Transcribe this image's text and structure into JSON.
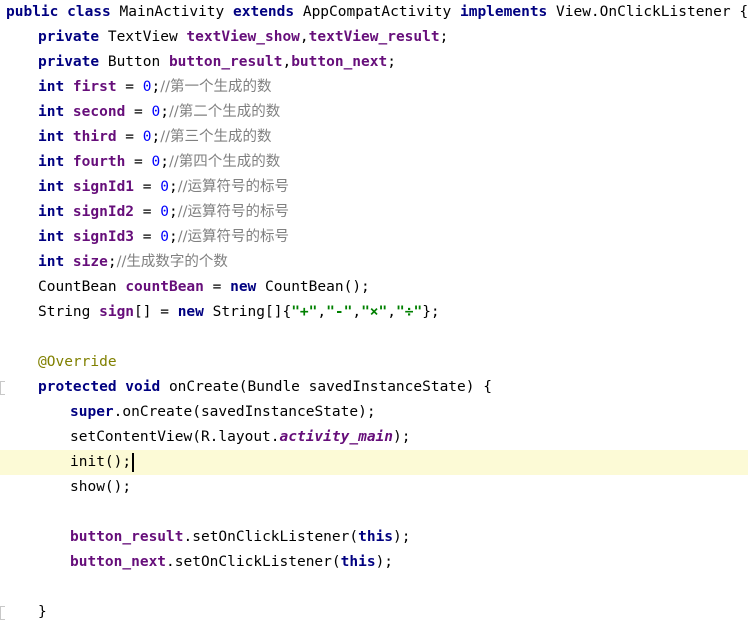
{
  "editor": {
    "lines": [
      {
        "indent": 0,
        "tokens": [
          {
            "t": "public class ",
            "c": "kw"
          },
          {
            "t": "MainActivity ",
            "c": "plain"
          },
          {
            "t": "extends ",
            "c": "kw"
          },
          {
            "t": "AppCompatActivity ",
            "c": "plain"
          },
          {
            "t": "implements ",
            "c": "kw"
          },
          {
            "t": "View.OnClickListener {",
            "c": "plain"
          }
        ]
      },
      {
        "indent": 1,
        "tokens": [
          {
            "t": "private ",
            "c": "kw"
          },
          {
            "t": "TextView ",
            "c": "plain"
          },
          {
            "t": "textView_show",
            "c": "fld"
          },
          {
            "t": ",",
            "c": "plain"
          },
          {
            "t": "textView_result",
            "c": "fld"
          },
          {
            "t": ";",
            "c": "plain"
          }
        ]
      },
      {
        "indent": 1,
        "tokens": [
          {
            "t": "private ",
            "c": "kw"
          },
          {
            "t": "Button ",
            "c": "plain"
          },
          {
            "t": "button_result",
            "c": "fld"
          },
          {
            "t": ",",
            "c": "plain"
          },
          {
            "t": "button_next",
            "c": "fld"
          },
          {
            "t": ";",
            "c": "plain"
          }
        ]
      },
      {
        "indent": 1,
        "tokens": [
          {
            "t": "int ",
            "c": "kw"
          },
          {
            "t": "first",
            "c": "fld"
          },
          {
            "t": " = ",
            "c": "plain"
          },
          {
            "t": "0",
            "c": "num"
          },
          {
            "t": ";",
            "c": "plain"
          },
          {
            "t": "//第一个生成的数",
            "c": "cmt"
          }
        ]
      },
      {
        "indent": 1,
        "tokens": [
          {
            "t": "int ",
            "c": "kw"
          },
          {
            "t": "second",
            "c": "fld"
          },
          {
            "t": " = ",
            "c": "plain"
          },
          {
            "t": "0",
            "c": "num"
          },
          {
            "t": ";",
            "c": "plain"
          },
          {
            "t": "//第二个生成的数",
            "c": "cmt"
          }
        ]
      },
      {
        "indent": 1,
        "tokens": [
          {
            "t": "int ",
            "c": "kw"
          },
          {
            "t": "third",
            "c": "fld"
          },
          {
            "t": " = ",
            "c": "plain"
          },
          {
            "t": "0",
            "c": "num"
          },
          {
            "t": ";",
            "c": "plain"
          },
          {
            "t": "//第三个生成的数",
            "c": "cmt"
          }
        ]
      },
      {
        "indent": 1,
        "tokens": [
          {
            "t": "int ",
            "c": "kw"
          },
          {
            "t": "fourth",
            "c": "fld"
          },
          {
            "t": " = ",
            "c": "plain"
          },
          {
            "t": "0",
            "c": "num"
          },
          {
            "t": ";",
            "c": "plain"
          },
          {
            "t": "//第四个生成的数",
            "c": "cmt"
          }
        ]
      },
      {
        "indent": 1,
        "tokens": [
          {
            "t": "int ",
            "c": "kw"
          },
          {
            "t": "signId1",
            "c": "fld"
          },
          {
            "t": " = ",
            "c": "plain"
          },
          {
            "t": "0",
            "c": "num"
          },
          {
            "t": ";",
            "c": "plain"
          },
          {
            "t": "//运算符号的标号",
            "c": "cmt"
          }
        ]
      },
      {
        "indent": 1,
        "tokens": [
          {
            "t": "int ",
            "c": "kw"
          },
          {
            "t": "signId2",
            "c": "fld"
          },
          {
            "t": " = ",
            "c": "plain"
          },
          {
            "t": "0",
            "c": "num"
          },
          {
            "t": ";",
            "c": "plain"
          },
          {
            "t": "//运算符号的标号",
            "c": "cmt"
          }
        ]
      },
      {
        "indent": 1,
        "tokens": [
          {
            "t": "int ",
            "c": "kw"
          },
          {
            "t": "signId3",
            "c": "fld"
          },
          {
            "t": " = ",
            "c": "plain"
          },
          {
            "t": "0",
            "c": "num"
          },
          {
            "t": ";",
            "c": "plain"
          },
          {
            "t": "//运算符号的标号",
            "c": "cmt"
          }
        ]
      },
      {
        "indent": 1,
        "tokens": [
          {
            "t": "int ",
            "c": "kw"
          },
          {
            "t": "size",
            "c": "fld"
          },
          {
            "t": ";",
            "c": "plain"
          },
          {
            "t": "//生成数字的个数",
            "c": "cmt"
          }
        ]
      },
      {
        "indent": 1,
        "tokens": [
          {
            "t": "CountBean ",
            "c": "plain"
          },
          {
            "t": "countBean",
            "c": "fld"
          },
          {
            "t": " = ",
            "c": "plain"
          },
          {
            "t": "new ",
            "c": "kw"
          },
          {
            "t": "CountBean();",
            "c": "plain"
          }
        ]
      },
      {
        "indent": 1,
        "tokens": [
          {
            "t": "String ",
            "c": "plain"
          },
          {
            "t": "sign",
            "c": "fld"
          },
          {
            "t": "[] = ",
            "c": "plain"
          },
          {
            "t": "new ",
            "c": "kw"
          },
          {
            "t": "String[]{",
            "c": "plain"
          },
          {
            "t": "\"+\"",
            "c": "str"
          },
          {
            "t": ",",
            "c": "plain"
          },
          {
            "t": "\"-\"",
            "c": "str"
          },
          {
            "t": ",",
            "c": "plain"
          },
          {
            "t": "\"×\"",
            "c": "str"
          },
          {
            "t": ",",
            "c": "plain"
          },
          {
            "t": "\"÷\"",
            "c": "str"
          },
          {
            "t": "};",
            "c": "plain"
          }
        ]
      },
      {
        "indent": 0,
        "tokens": []
      },
      {
        "indent": 1,
        "tokens": [
          {
            "t": "@Override",
            "c": "ann"
          }
        ]
      },
      {
        "indent": 1,
        "gutter": true,
        "tokens": [
          {
            "t": "protected void ",
            "c": "kw"
          },
          {
            "t": "onCreate(Bundle savedInstanceState) {",
            "c": "plain"
          }
        ]
      },
      {
        "indent": 2,
        "tokens": [
          {
            "t": "super",
            "c": "kw"
          },
          {
            "t": ".onCreate(savedInstanceState);",
            "c": "plain"
          }
        ]
      },
      {
        "indent": 2,
        "tokens": [
          {
            "t": "setContentView(R.layout.",
            "c": "plain"
          },
          {
            "t": "activity_main",
            "c": "fld-it"
          },
          {
            "t": ");",
            "c": "plain"
          }
        ]
      },
      {
        "indent": 2,
        "current": true,
        "caret": true,
        "tokens": [
          {
            "t": "init();",
            "c": "plain"
          }
        ]
      },
      {
        "indent": 2,
        "tokens": [
          {
            "t": "show();",
            "c": "plain"
          }
        ]
      },
      {
        "indent": 0,
        "tokens": []
      },
      {
        "indent": 2,
        "tokens": [
          {
            "t": "button_result",
            "c": "fld"
          },
          {
            "t": ".setOnClickListener(",
            "c": "plain"
          },
          {
            "t": "this",
            "c": "kw"
          },
          {
            "t": ");",
            "c": "plain"
          }
        ]
      },
      {
        "indent": 2,
        "tokens": [
          {
            "t": "button_next",
            "c": "fld"
          },
          {
            "t": ".setOnClickListener(",
            "c": "plain"
          },
          {
            "t": "this",
            "c": "kw"
          },
          {
            "t": ");",
            "c": "plain"
          }
        ]
      },
      {
        "indent": 0,
        "tokens": []
      },
      {
        "indent": 1,
        "gutter": true,
        "tokens": [
          {
            "t": "}",
            "c": "plain"
          }
        ]
      }
    ]
  }
}
